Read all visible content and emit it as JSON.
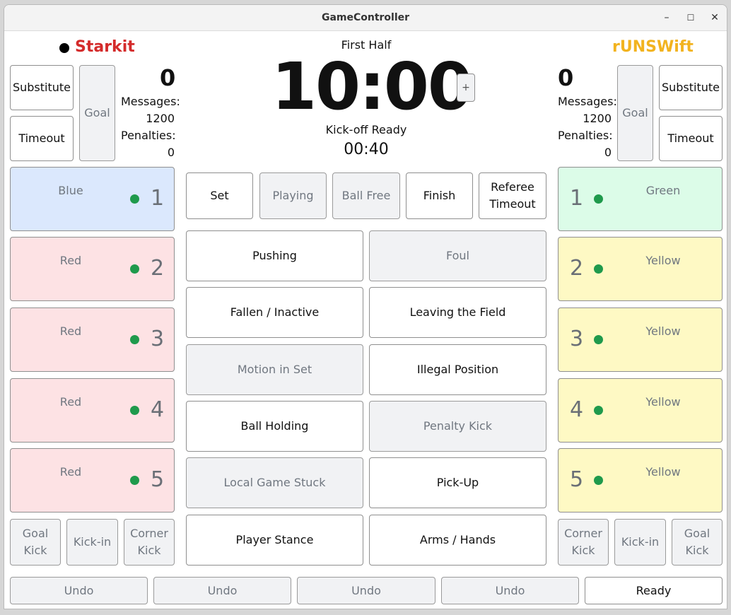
{
  "window": {
    "title": "GameController",
    "controls": {
      "minimize": "–",
      "maximize": "☐",
      "close": "✕"
    }
  },
  "colors": {
    "home_team": "#d42b2b",
    "away_team": "#f2b31f",
    "status_dot": "#1f9a4c",
    "blue_player": "#dbe8fd",
    "red_player": "#fde2e4",
    "green_player": "#dcfce8",
    "yellow_player": "#fef9c4"
  },
  "home": {
    "name": "Starkit",
    "score": "0",
    "messages_label": "Messages:",
    "messages_value": "1200",
    "penalties_label": "Penalties:",
    "penalties_value": "0",
    "substitute": "Substitute",
    "timeout": "Timeout",
    "goal": "Goal",
    "players": [
      {
        "color": "Blue",
        "number": "1"
      },
      {
        "color": "Red",
        "number": "2"
      },
      {
        "color": "Red",
        "number": "3"
      },
      {
        "color": "Red",
        "number": "4"
      },
      {
        "color": "Red",
        "number": "5"
      }
    ],
    "goal_kick": "Goal Kick",
    "kick_in": "Kick-in",
    "corner_kick": "Corner Kick"
  },
  "away": {
    "name": "rUNSWift",
    "score": "0",
    "messages_label": "Messages:",
    "messages_value": "1200",
    "penalties_label": "Penalties:",
    "penalties_value": "0",
    "substitute": "Substitute",
    "timeout": "Timeout",
    "goal": "Goal",
    "players": [
      {
        "color": "Green",
        "number": "1"
      },
      {
        "color": "Yellow",
        "number": "2"
      },
      {
        "color": "Yellow",
        "number": "3"
      },
      {
        "color": "Yellow",
        "number": "4"
      },
      {
        "color": "Yellow",
        "number": "5"
      }
    ],
    "goal_kick": "Goal Kick",
    "kick_in": "Kick-in",
    "corner_kick": "Corner Kick"
  },
  "center": {
    "half": "First Half",
    "clock": "10:00",
    "plus": "+",
    "state": "Kick-off Ready",
    "secondary_clock": "00:40",
    "state_buttons": [
      "Set",
      "Playing",
      "Ball Free",
      "Finish",
      "Referee Timeout"
    ],
    "penalties": [
      "Pushing",
      "Foul",
      "Fallen / Inactive",
      "Leaving the Field",
      "Motion in Set",
      "Illegal Position",
      "Ball Holding",
      "Penalty Kick",
      "Local Game Stuck",
      "Pick-Up",
      "Player Stance",
      "Arms / Hands"
    ]
  },
  "bottom": {
    "undo": [
      "Undo",
      "Undo",
      "Undo",
      "Undo"
    ],
    "ready": "Ready"
  }
}
